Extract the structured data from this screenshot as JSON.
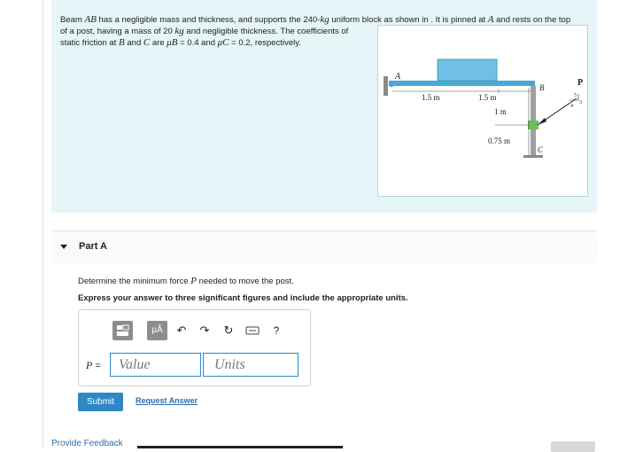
{
  "problem": {
    "line1_pre": "Beam ",
    "line1_ab": "AB",
    "line1_mid": " has a negligible mass and thickness, and supports the 240-",
    "line1_kg": "kg",
    "line1_post": " uniform block as shown in . It is pinned at ",
    "line1_a": "A",
    "line1_end": " and rests on the top",
    "line2_pre": "of a post, having a mass of 20 ",
    "line2_kg": "kg",
    "line2_post": " and negligible thickness. The coefficients of",
    "line3_pre": "static friction at ",
    "line3_b": "B",
    "line3_and": " and ",
    "line3_c": "C",
    "line3_are": " are ",
    "mu_b": "μB",
    "mu_b_val": " = 0.4 and ",
    "mu_c": "μC",
    "mu_c_val": " = 0.2, respectively."
  },
  "figure": {
    "label_a": "A",
    "label_b": "B",
    "label_c": "C",
    "label_p": "P",
    "dim_1": "1.5 m",
    "dim_2": "1.5 m",
    "dim_3": "1 m",
    "dim_4": "0.75 m",
    "slope_5": "5",
    "slope_3": "3",
    "slope_4": "4"
  },
  "part_a": {
    "title": "Part A",
    "question_pre": "Determine the minimum force ",
    "question_var": "P",
    "question_post": " needed to move the post.",
    "instruction": "Express your answer to three significant figures and include the appropriate units."
  },
  "answer": {
    "p_var": "P",
    "p_eq": " =",
    "value_placeholder": "Value",
    "units_placeholder": "Units",
    "toolbar_unit_label": "μÅ",
    "toolbar_help": "?"
  },
  "actions": {
    "submit": "Submit",
    "request": "Request Answer",
    "feedback": "Provide Feedback"
  }
}
